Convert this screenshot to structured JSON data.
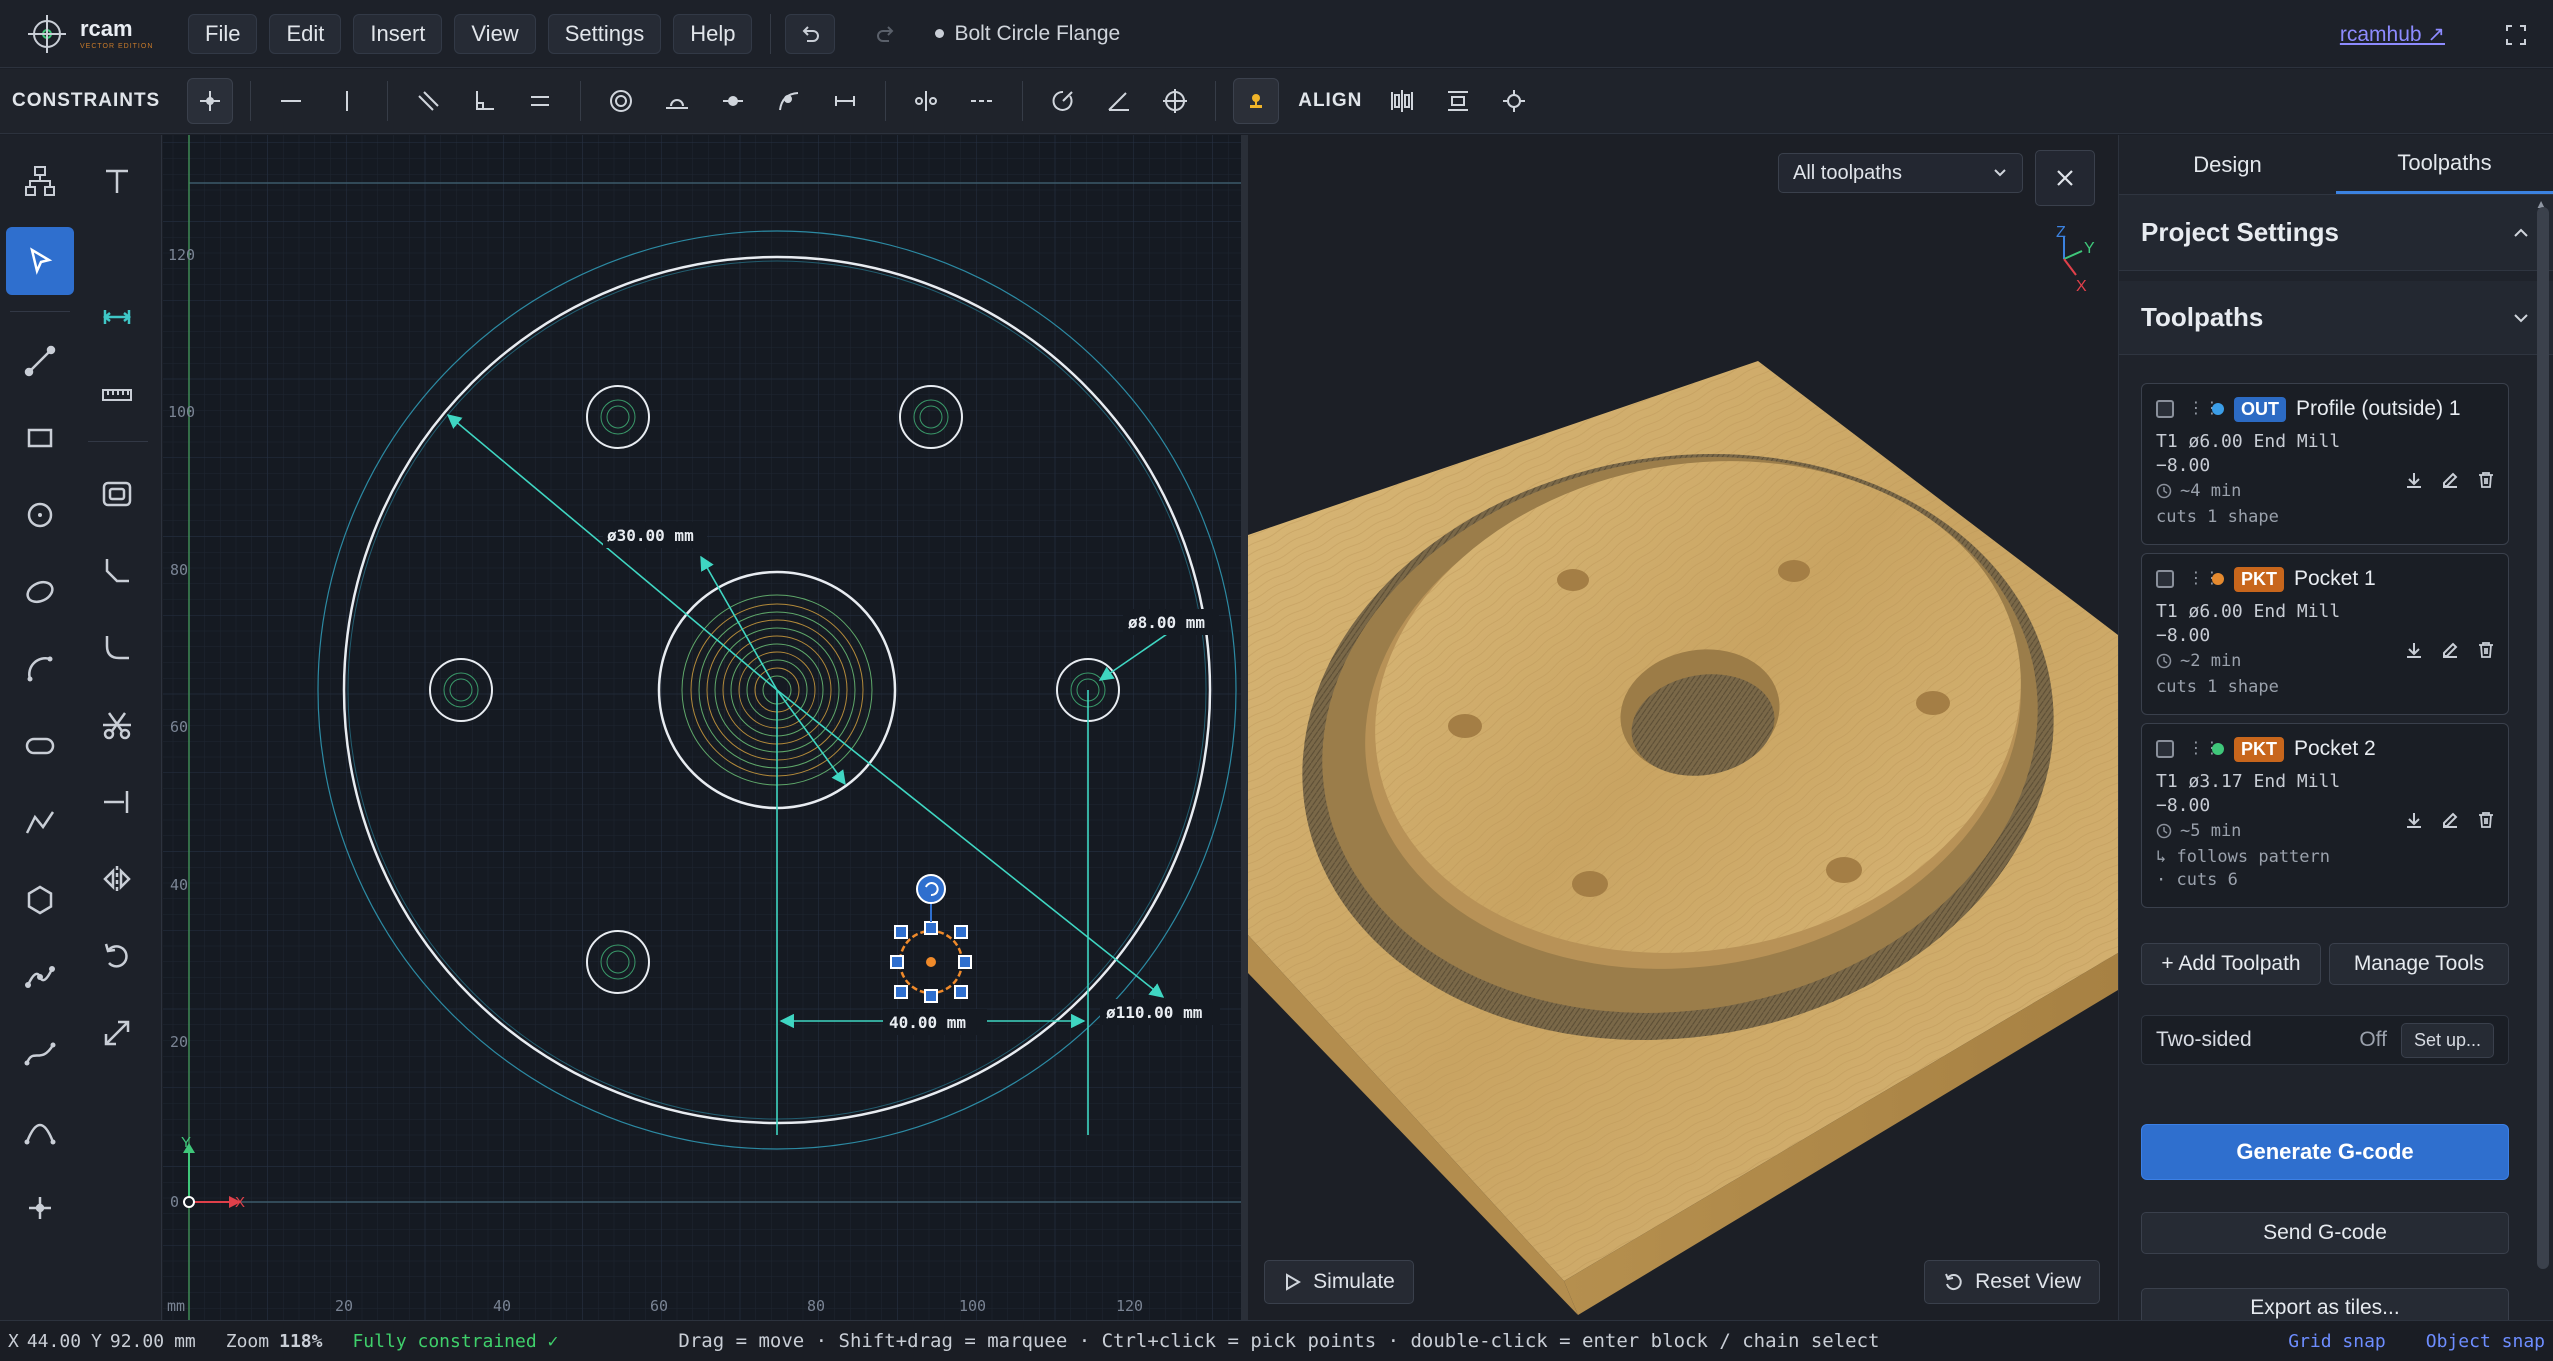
{
  "app": {
    "brand": "rcam",
    "edition": "VECTOR EDITION",
    "document_title": "Bolt Circle Flange",
    "hub_link": "rcamhub ↗"
  },
  "menu": {
    "items": [
      "File",
      "Edit",
      "Insert",
      "View",
      "Settings",
      "Help"
    ]
  },
  "constraints_bar": {
    "title": "CONSTRAINTS",
    "align_label": "ALIGN"
  },
  "sketch": {
    "dimensions": {
      "d30": "ø30.00 mm",
      "d8": "ø8.00 mm",
      "d110": "ø110.00 mm",
      "len40": "40.00 mm"
    },
    "axis": {
      "x_ticks": [
        "20",
        "40",
        "60",
        "80",
        "100",
        "120"
      ],
      "y_ticks": [
        "120",
        "100",
        "80",
        "60",
        "40",
        "20",
        "0"
      ],
      "unit": "mm",
      "x_label": "X",
      "y_label": "Y"
    }
  },
  "view3d": {
    "filter_value": "All toolpaths",
    "simulate_label": "Simulate",
    "reset_label": "Reset View",
    "gizmo": {
      "x": "X",
      "y": "Y",
      "z": "Z"
    }
  },
  "panel": {
    "tabs": [
      "Design",
      "Toolpaths"
    ],
    "project_settings_title": "Project Settings",
    "toolpaths_title": "Toolpaths",
    "toolpaths": [
      {
        "badge": "OUT",
        "name": "Profile (outside) 1",
        "tool": "T1 ø6.00 End Mill",
        "depth": "−8.00",
        "time": "~4 min",
        "note": "cuts 1 shape",
        "dot_color": "#3b9ee8",
        "badge_color": "#2c6bc4"
      },
      {
        "badge": "PKT",
        "name": "Pocket 1",
        "tool": "T1 ø6.00 End Mill",
        "depth": "−8.00",
        "time": "~2 min",
        "note": "cuts 1 shape",
        "dot_color": "#e58a2f",
        "badge_color": "#c8661c"
      },
      {
        "badge": "PKT",
        "name": "Pocket 2",
        "tool": "T1 ø3.17 End Mill",
        "depth": "−8.00",
        "time": "~5 min",
        "note": "↳ follows pattern",
        "note2": "· cuts 6",
        "dot_color": "#3fc77a",
        "badge_color": "#c8661c"
      }
    ],
    "add_toolpath": "+ Add Toolpath",
    "manage_tools": "Manage Tools",
    "two_sided": {
      "label": "Two-sided",
      "state": "Off",
      "setup": "Set up..."
    },
    "generate": "Generate G-code",
    "send": "Send G-code",
    "export": "Export as tiles..."
  },
  "status": {
    "x_label": "X",
    "x_value": "44.00",
    "y_label": "Y",
    "y_value": "92.00",
    "unit": "mm",
    "zoom_label": "Zoom",
    "zoom_value": "118%",
    "constraint_state": "Fully constrained ✓",
    "hint": "Drag = move · Shift+drag = marquee · Ctrl+click = pick points · double-click = enter block / chain select",
    "grid_snap": "Grid snap",
    "object_snap": "Object snap"
  }
}
